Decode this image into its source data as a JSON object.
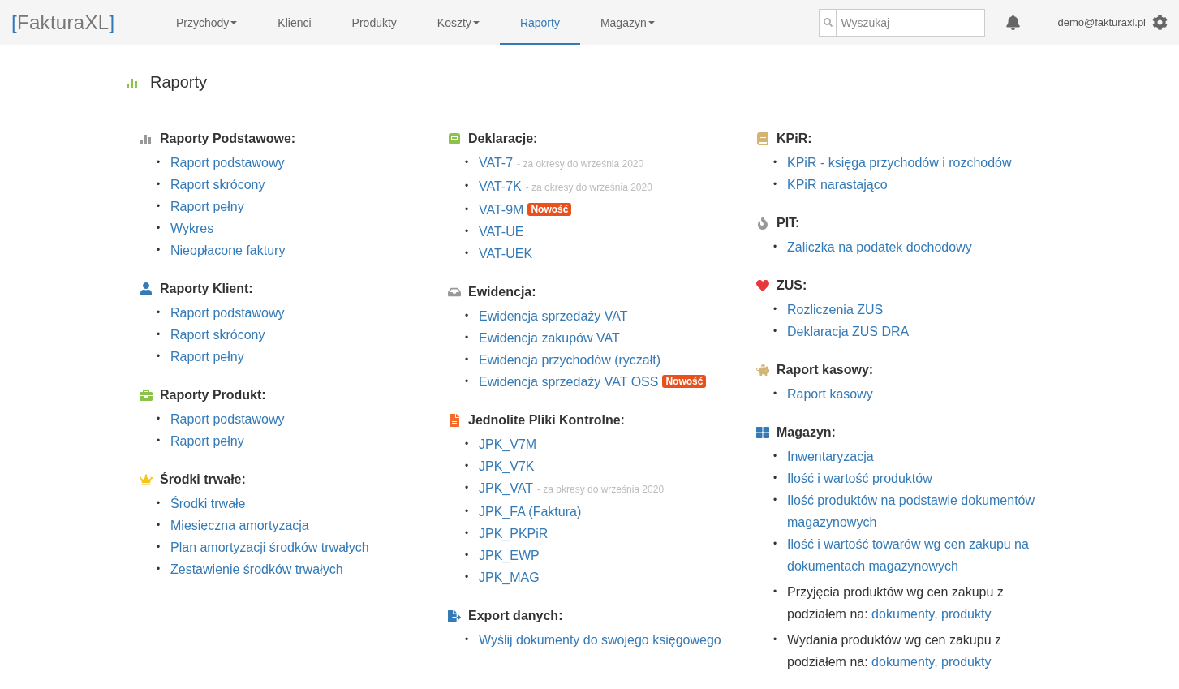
{
  "header": {
    "logo": {
      "open": "[",
      "name": "FakturaXL",
      "close": "]"
    },
    "nav": [
      {
        "label": "Przychody",
        "dropdown": true,
        "selected": false
      },
      {
        "label": "Klienci",
        "dropdown": false,
        "selected": false
      },
      {
        "label": "Produkty",
        "dropdown": false,
        "selected": false
      },
      {
        "label": "Koszty",
        "dropdown": true,
        "selected": false
      },
      {
        "label": "Raporty",
        "dropdown": false,
        "selected": true
      },
      {
        "label": "Magazyn",
        "dropdown": true,
        "selected": false
      }
    ],
    "search": {
      "placeholder": "Wyszukaj"
    },
    "user": "demo@fakturaxl.pl"
  },
  "page_title": "Raporty",
  "columns": [
    [
      {
        "title": "Raporty Podstawowe:",
        "items": [
          {
            "kind": "link",
            "bullet": "•",
            "text": "Raport podstawowy"
          },
          {
            "kind": "link",
            "bullet": "•",
            "text": "Raport skrócony"
          },
          {
            "kind": "link",
            "bullet": "•",
            "text": "Raport pełny"
          },
          {
            "kind": "link",
            "bullet": "•",
            "text": "Wykres"
          },
          {
            "kind": "link",
            "bullet": "•",
            "text": "Nieopłacone faktury"
          }
        ]
      },
      {
        "title": "Raporty Klient:",
        "items": [
          {
            "kind": "link",
            "bullet": "•",
            "text": "Raport podstawowy"
          },
          {
            "kind": "link",
            "bullet": "•",
            "text": "Raport skrócony"
          },
          {
            "kind": "link",
            "bullet": "•",
            "text": "Raport pełny"
          }
        ]
      },
      {
        "title": "Raporty Produkt:",
        "items": [
          {
            "kind": "link",
            "bullet": "•",
            "text": "Raport podstawowy"
          },
          {
            "kind": "link",
            "bullet": "•",
            "text": "Raport pełny"
          }
        ]
      },
      {
        "title": "Środki trwałe:",
        "items": [
          {
            "kind": "link",
            "bullet": "•",
            "text": "Środki trwałe"
          },
          {
            "kind": "link",
            "bullet": "•",
            "text": "Miesięczna amortyzacja"
          },
          {
            "kind": "link",
            "bullet": "•",
            "text": "Plan amortyzacji środków trwałych"
          },
          {
            "kind": "link",
            "bullet": "•",
            "text": "Zestawienie środków trwałych"
          }
        ]
      }
    ],
    [
      {
        "title": "Deklaracje:",
        "items": [
          {
            "kind": "link",
            "bullet": "•",
            "text": "VAT-7",
            "note": "- za okresy do września 2020"
          },
          {
            "kind": "link",
            "bullet": "•",
            "text": "VAT-7K",
            "note": "- za okresy do września 2020"
          },
          {
            "kind": "link",
            "bullet": "•",
            "text": "VAT-9M",
            "badge": "Nowość"
          },
          {
            "kind": "link",
            "bullet": "•",
            "text": "VAT-UE"
          },
          {
            "kind": "link",
            "bullet": "•",
            "text": "VAT-UEK"
          }
        ]
      },
      {
        "title": "Ewidencja:",
        "items": [
          {
            "kind": "link",
            "bullet": "•",
            "text": "Ewidencja sprzedaży VAT"
          },
          {
            "kind": "link",
            "bullet": "•",
            "text": "Ewidencja zakupów VAT"
          },
          {
            "kind": "link",
            "bullet": "•",
            "text": "Ewidencja przychodów (ryczałt)"
          },
          {
            "kind": "link",
            "bullet": "•",
            "text": "Ewidencja sprzedaży VAT OSS",
            "badge": "Nowość"
          }
        ]
      },
      {
        "title": "Jednolite Pliki Kontrolne:",
        "items": [
          {
            "kind": "link",
            "bullet": "•",
            "text": "JPK_V7M"
          },
          {
            "kind": "link",
            "bullet": "•",
            "text": "JPK_V7K"
          },
          {
            "kind": "link",
            "bullet": "•",
            "text": "JPK_VAT",
            "note": "- za okresy do września 2020"
          },
          {
            "kind": "link",
            "bullet": "•",
            "text": "JPK_FA (Faktura)"
          },
          {
            "kind": "link",
            "bullet": "•",
            "text": "JPK_PKPiR"
          },
          {
            "kind": "link",
            "bullet": "•",
            "text": "JPK_EWP"
          },
          {
            "kind": "link",
            "bullet": "•",
            "text": "JPK_MAG"
          }
        ]
      },
      {
        "title": "Export danych:",
        "items": [
          {
            "kind": "link",
            "bullet": "•",
            "text": "Wyślij dokumenty do swojego księgowego"
          }
        ]
      }
    ],
    [
      {
        "title": "KPiR:",
        "items": [
          {
            "kind": "link",
            "bullet": "•",
            "text": "KPiR - księga przychodów i rozchodów"
          },
          {
            "kind": "link",
            "bullet": "•",
            "text": "KPiR narastająco"
          }
        ]
      },
      {
        "title": "PIT:",
        "items": [
          {
            "kind": "link",
            "bullet": "•",
            "text": "Zaliczka na podatek dochodowy"
          }
        ]
      },
      {
        "title": "ZUS:",
        "items": [
          {
            "kind": "link",
            "bullet": "•",
            "text": "Rozliczenia ZUS"
          },
          {
            "kind": "link",
            "bullet": "•",
            "text": "Deklaracja ZUS DRA"
          }
        ]
      },
      {
        "title": "Raport kasowy:",
        "items": [
          {
            "kind": "link",
            "bullet": "•",
            "text": "Raport kasowy"
          }
        ]
      },
      {
        "title": "Magazyn:",
        "items": [
          {
            "kind": "link",
            "bullet": "•",
            "text": "Inwentaryzacja"
          },
          {
            "kind": "link",
            "bullet": "•",
            "text": "Ilość i wartość produktów"
          },
          {
            "kind": "link",
            "bullet": "•",
            "text": "Ilość produktów na podstawie dokumentów magazynowych"
          },
          {
            "kind": "link",
            "bullet": "•",
            "text": "Ilość i wartość towarów wg cen zakupu na dokumentach magazynowych"
          },
          {
            "kind": "mixed",
            "bullet": "•",
            "text": "Przyjęcia produktów wg cen zakupu z podziałem na:",
            "links": [
              "dokumenty,",
              "produkty"
            ]
          },
          {
            "kind": "mixed",
            "bullet": "•",
            "text": "Wydania produktów wg cen zakupu z podziałem na:",
            "links": [
              "dokumenty,",
              "produkty"
            ]
          }
        ]
      }
    ]
  ]
}
